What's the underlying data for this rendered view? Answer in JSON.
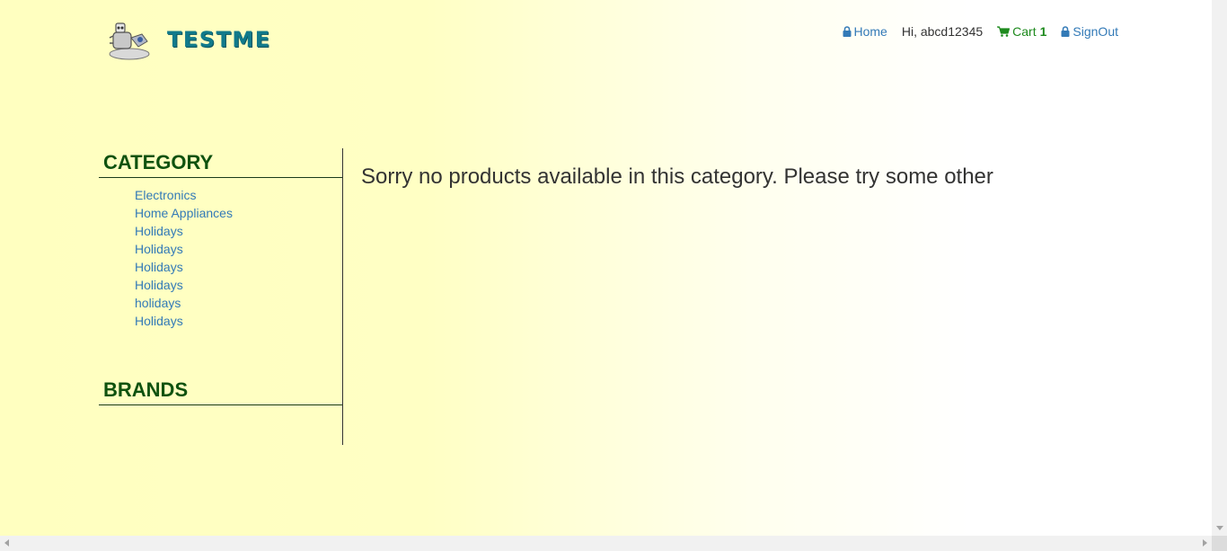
{
  "header": {
    "brand": "TESTME",
    "logo_icon": "robot-logo-icon",
    "nav": {
      "home": "Home",
      "greeting": "Hi, abcd12345",
      "cart_label": "Cart",
      "cart_count": "1",
      "signout": "SignOut"
    }
  },
  "sidebar": {
    "category_title": "CATEGORY",
    "categories": [
      "Electronics",
      "Home Appliances",
      "Holidays",
      "Holidays",
      "Holidays",
      "Holidays",
      "holidays",
      "Holidays"
    ],
    "brands_title": "BRANDS"
  },
  "main": {
    "message": "Sorry no products available in this category. Please try some other"
  },
  "colors": {
    "link": "#337ab7",
    "heading": "#0f520f",
    "cart": "#1e8a1e",
    "brand": "#117a8b",
    "bg_start": "#ffffc0",
    "bg_end": "#ffffff"
  }
}
